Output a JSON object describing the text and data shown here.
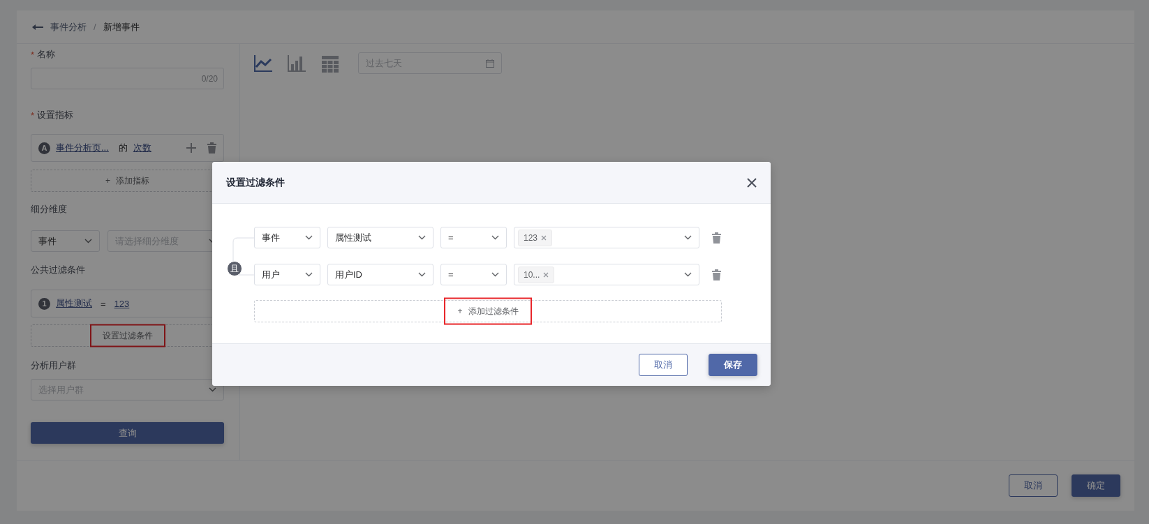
{
  "breadcrumb": {
    "parent": "事件分析",
    "separator": "/",
    "current": "新增事件"
  },
  "form": {
    "name": {
      "required_mark": "*",
      "label": "名称",
      "counter": "0/20"
    },
    "metrics": {
      "required_mark": "*",
      "label": "设置指标",
      "badge": "A",
      "event": "事件分析页...",
      "joiner": "的",
      "measure": "次数",
      "add_icon": "+",
      "add_label": "添加指标"
    },
    "breakdown": {
      "label": "细分维度",
      "type": "事件",
      "placeholder": "请选择细分维度"
    },
    "filters": {
      "label": "公共过滤条件",
      "badge": "1",
      "property": "属性测试",
      "operator": "=",
      "value": "123",
      "button": "设置过滤条件",
      "highlighted": true
    },
    "group": {
      "label": "分析用户群",
      "placeholder": "选择用户群"
    },
    "query": "查询"
  },
  "toolbar": {
    "chart_types": [
      {
        "kind": "line",
        "selected": true
      },
      {
        "kind": "bar",
        "selected": false
      },
      {
        "kind": "table",
        "selected": false
      }
    ],
    "date_placeholder": "过去七天"
  },
  "footer": {
    "cancel": "取消",
    "confirm": "确定"
  },
  "modal": {
    "title": "设置过滤条件",
    "logic": "且",
    "conditions": [
      {
        "scope": "事件",
        "property": "属性测试",
        "operator": "=",
        "values": [
          "123"
        ]
      },
      {
        "scope": "用户",
        "property": "用户ID",
        "operator": "=",
        "values": [
          "10..."
        ]
      }
    ],
    "add_condition": {
      "icon": "+",
      "label": "添加过滤条件",
      "highlighted": true
    },
    "cancel": "取消",
    "save": "保存"
  }
}
